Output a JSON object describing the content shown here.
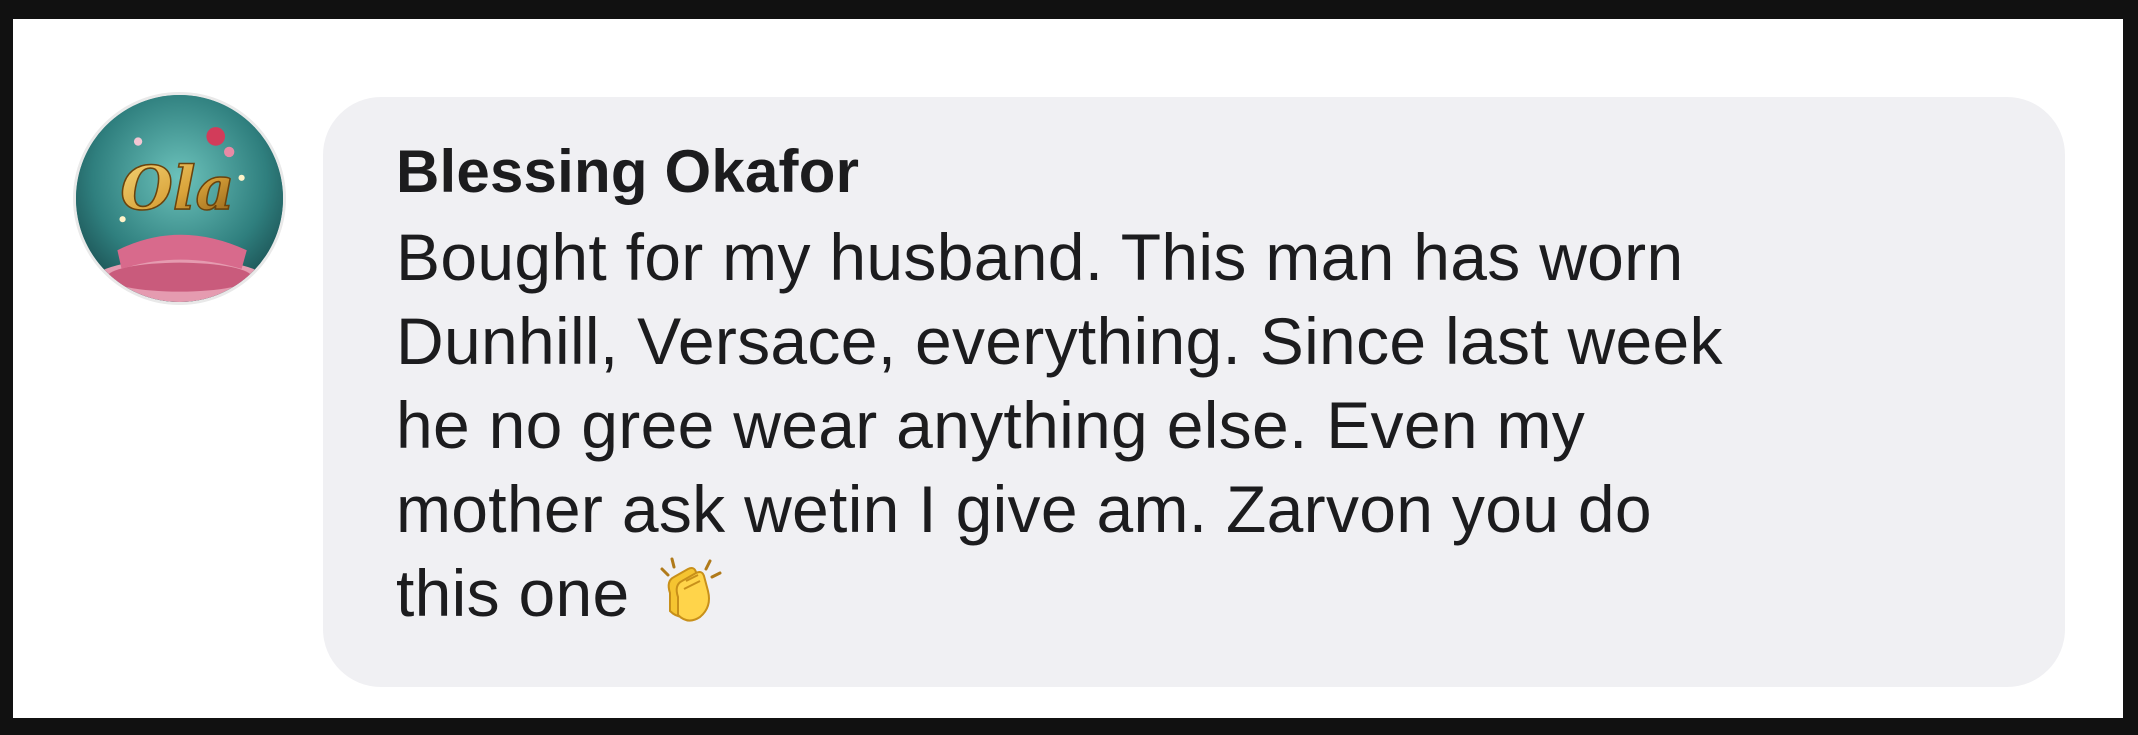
{
  "comment": {
    "author": "Blessing Okafor",
    "avatar_icon": "profile-avatar-ola",
    "avatar_text": "Ola",
    "text_lines": [
      "Bought for my husband. This man has worn",
      "Dunhill, Versace, everything. Since last week",
      "he no gree wear anything else. Even my",
      "mother ask wetin I give am. Zarvon you do",
      "this one"
    ],
    "emoji_icon": "clapping-hands-emoji"
  },
  "colors": {
    "page_border": "#111111",
    "background": "#ffffff",
    "bubble": "#f0f0f3",
    "text": "#1c1c1e",
    "avatar_teal": "#2f7f7e",
    "avatar_gold": "#d9a33a",
    "avatar_pink": "#e07a9a"
  }
}
